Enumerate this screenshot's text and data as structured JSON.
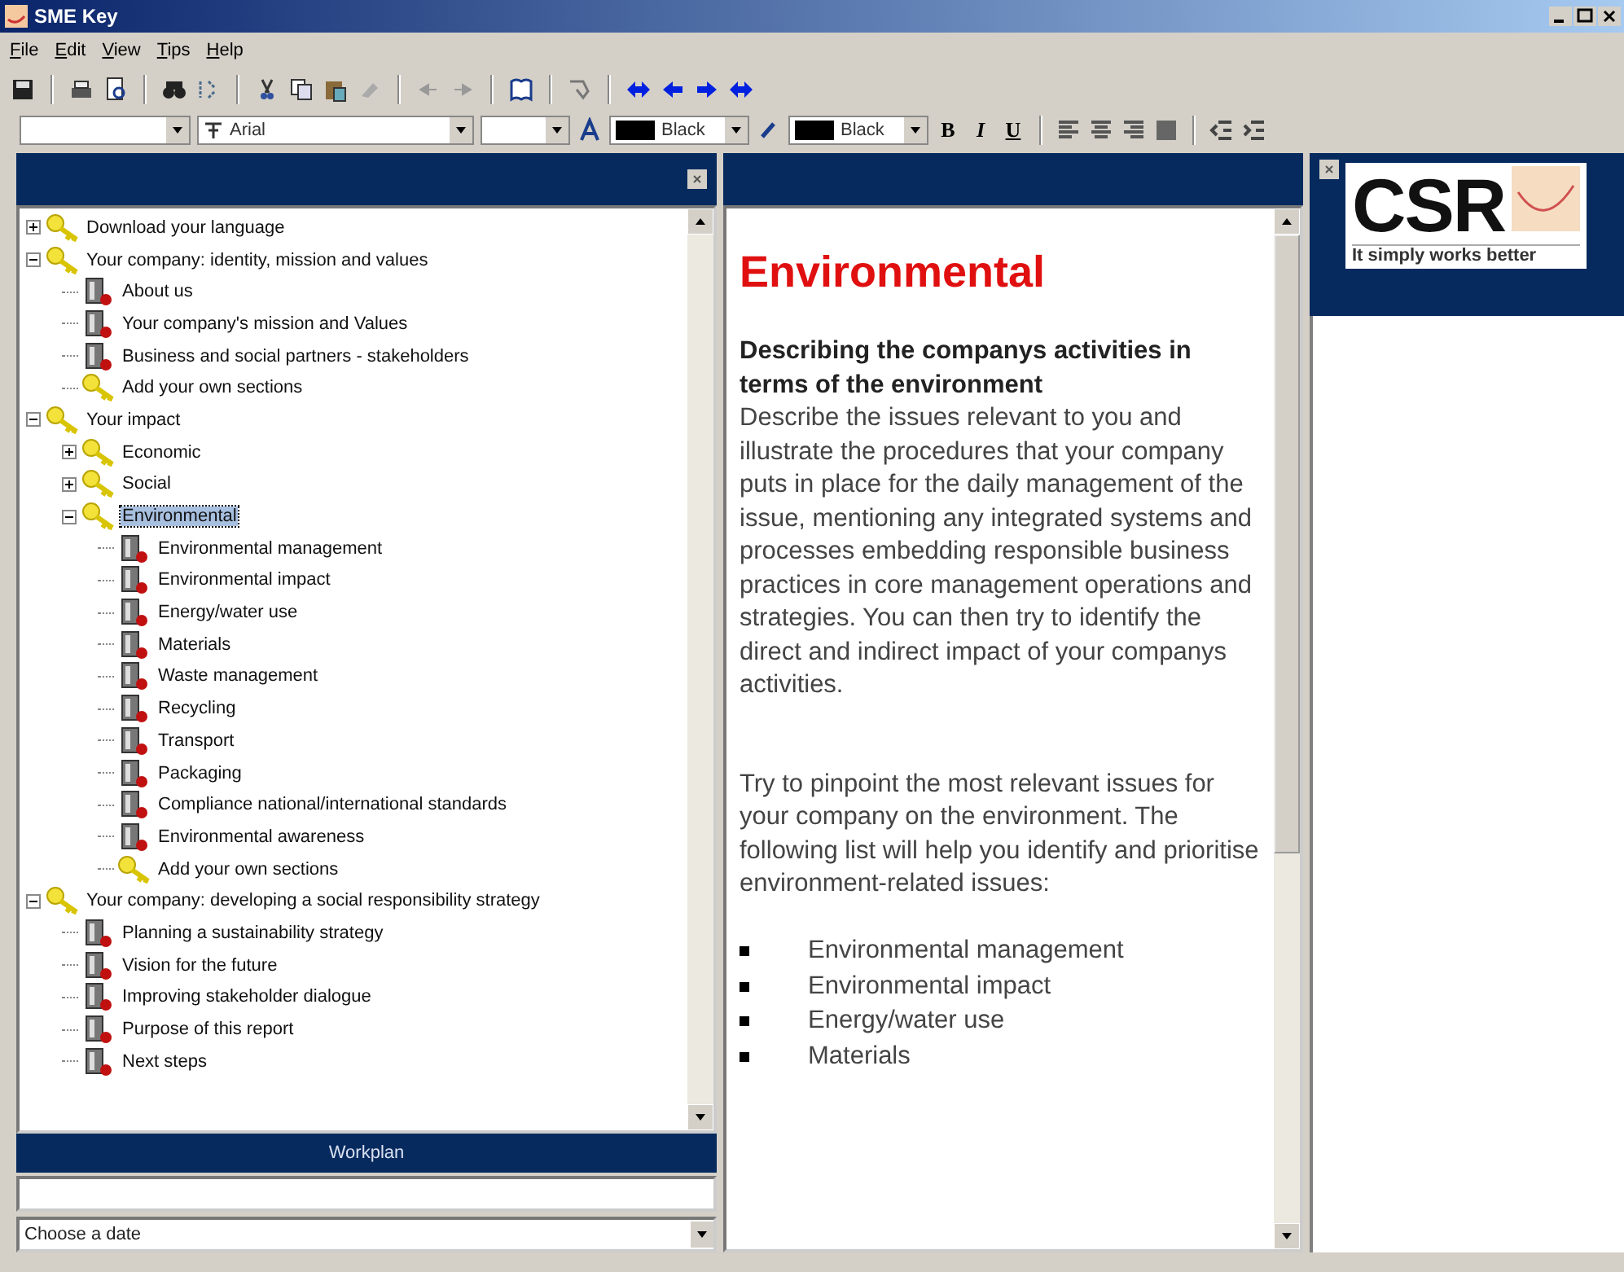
{
  "window": {
    "title": "SME Key"
  },
  "menu": [
    "File",
    "Edit",
    "View",
    "Tips",
    "Help"
  ],
  "format_bar": {
    "font": "Arial",
    "text_color": "Black",
    "highlight_color": "Black",
    "bold": "B",
    "italic": "I",
    "underline": "U"
  },
  "tree": [
    {
      "label": "Download your language",
      "kind": "section",
      "expanded": false,
      "selected": false
    },
    {
      "label": "Your company: identity, mission and values",
      "kind": "section",
      "expanded": true,
      "selected": false,
      "children": [
        {
          "label": "About us",
          "kind": "page",
          "selected": false
        },
        {
          "label": "Your company's mission and Values",
          "kind": "page",
          "selected": false
        },
        {
          "label": "Business and social partners - stakeholders",
          "kind": "page",
          "selected": false
        },
        {
          "label": "Add your own sections",
          "kind": "section",
          "selected": false
        }
      ]
    },
    {
      "label": "Your impact",
      "kind": "section",
      "expanded": true,
      "selected": false,
      "children": [
        {
          "label": "Economic",
          "kind": "section",
          "expanded": false,
          "selected": false
        },
        {
          "label": "Social",
          "kind": "section",
          "expanded": false,
          "selected": false
        },
        {
          "label": "Environmental",
          "kind": "section",
          "expanded": true,
          "selected": true,
          "children": [
            {
              "label": "Environmental management",
              "kind": "page",
              "selected": false
            },
            {
              "label": "Environmental impact",
              "kind": "page",
              "selected": false
            },
            {
              "label": "Energy/water use",
              "kind": "page",
              "selected": false
            },
            {
              "label": "Materials",
              "kind": "page",
              "selected": false
            },
            {
              "label": "Waste management",
              "kind": "page",
              "selected": false
            },
            {
              "label": "Recycling",
              "kind": "page",
              "selected": false
            },
            {
              "label": "Transport",
              "kind": "page",
              "selected": false
            },
            {
              "label": "Packaging",
              "kind": "page",
              "selected": false
            },
            {
              "label": "Compliance national/international standards",
              "kind": "page",
              "selected": false
            },
            {
              "label": "Environmental awareness",
              "kind": "page",
              "selected": false
            },
            {
              "label": "Add your own sections",
              "kind": "section",
              "selected": false
            }
          ]
        }
      ]
    },
    {
      "label": "Your company: developing a social responsibility strategy",
      "kind": "section",
      "expanded": true,
      "selected": false,
      "children": [
        {
          "label": "Planning a sustainability strategy",
          "kind": "page",
          "selected": false
        },
        {
          "label": "Vision for the future",
          "kind": "page",
          "selected": false
        },
        {
          "label": "Improving stakeholder dialogue",
          "kind": "page",
          "selected": false
        },
        {
          "label": "Purpose of this report",
          "kind": "page",
          "selected": false
        },
        {
          "label": "Next steps",
          "kind": "page",
          "selected": false
        }
      ]
    }
  ],
  "workplan": {
    "title": "Workplan",
    "date_placeholder": "Choose a date"
  },
  "document": {
    "heading": "Environmental",
    "subheading": "Describing the companys activities in terms of the environment",
    "paragraphs": [
      "Describe the issues relevant to you and illustrate the procedures that your company puts in place for the daily management of the issue, mentioning any integrated systems and processes embedding responsible business practices in core management operations and strategies. You can then try to identify the direct and indirect impact of your companys activities.",
      "Try to pinpoint the most relevant issues for your company on the environment. The following list will help you identify and prioritise environment-related issues:"
    ],
    "bullets": [
      "Environmental management",
      "Environmental impact",
      "Energy/water use",
      "Materials"
    ]
  },
  "logo": {
    "mark": "CSR",
    "tagline": "It simply works better"
  }
}
